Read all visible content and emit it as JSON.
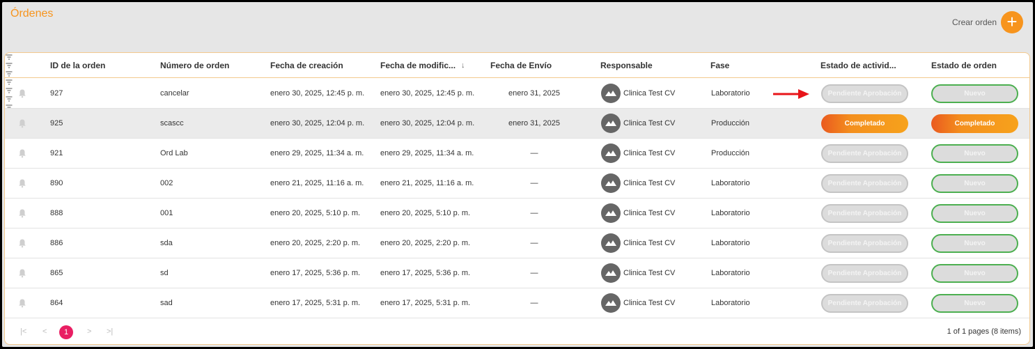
{
  "header": {
    "title": "Órdenes",
    "create_label": "Crear orden",
    "create_icon": "plus-icon"
  },
  "columns": [
    {
      "label": "ID de la orden"
    },
    {
      "label": "Número de orden"
    },
    {
      "label": "Fecha de creación"
    },
    {
      "label": "Fecha de modific...",
      "sort": "↓"
    },
    {
      "label": "Fecha de Envío"
    },
    {
      "label": "Responsable"
    },
    {
      "label": "Fase"
    },
    {
      "label": "Estado de activid..."
    },
    {
      "label": "Estado de orden"
    }
  ],
  "rows": [
    {
      "id": "927",
      "numero": "cancelar",
      "creacion": "enero 30, 2025, 12:45 p. m.",
      "modificacion": "enero 30, 2025, 12:45 p. m.",
      "envio": "enero 31, 2025",
      "responsable": "Clinica Test CV",
      "fase": "Laboratorio",
      "actividad": "Pendiente Aprobación",
      "orden": "Nuevo"
    },
    {
      "id": "925",
      "numero": "scascc",
      "creacion": "enero 30, 2025, 12:04 p. m.",
      "modificacion": "enero 30, 2025, 12:04 p. m.",
      "envio": "enero 31, 2025",
      "responsable": "Clinica Test CV",
      "fase": "Producción",
      "actividad": "Completado",
      "orden": "Completado"
    },
    {
      "id": "921",
      "numero": "Ord Lab",
      "creacion": "enero 29, 2025, 11:34 a. m.",
      "modificacion": "enero 29, 2025, 11:34 a. m.",
      "envio": "—",
      "responsable": "Clinica Test CV",
      "fase": "Producción",
      "actividad": "Pendiente Aprobación",
      "orden": "Nuevo"
    },
    {
      "id": "890",
      "numero": "002",
      "creacion": "enero 21, 2025, 11:16 a. m.",
      "modificacion": "enero 21, 2025, 11:16 a. m.",
      "envio": "—",
      "responsable": "Clinica Test CV",
      "fase": "Laboratorio",
      "actividad": "Pendiente Aprobación",
      "orden": "Nuevo"
    },
    {
      "id": "888",
      "numero": "001",
      "creacion": "enero 20, 2025, 5:10 p. m.",
      "modificacion": "enero 20, 2025, 5:10 p. m.",
      "envio": "—",
      "responsable": "Clinica Test CV",
      "fase": "Laboratorio",
      "actividad": "Pendiente Aprobación",
      "orden": "Nuevo"
    },
    {
      "id": "886",
      "numero": "sda",
      "creacion": "enero 20, 2025, 2:20 p. m.",
      "modificacion": "enero 20, 2025, 2:20 p. m.",
      "envio": "—",
      "responsable": "Clinica Test CV",
      "fase": "Laboratorio",
      "actividad": "Pendiente Aprobación",
      "orden": "Nuevo"
    },
    {
      "id": "865",
      "numero": "sd",
      "creacion": "enero 17, 2025, 5:36 p. m.",
      "modificacion": "enero 17, 2025, 5:36 p. m.",
      "envio": "—",
      "responsable": "Clinica Test CV",
      "fase": "Laboratorio",
      "actividad": "Pendiente Aprobación",
      "orden": "Nuevo"
    },
    {
      "id": "864",
      "numero": "sad",
      "creacion": "enero 17, 2025, 5:31 p. m.",
      "modificacion": "enero 17, 2025, 5:31 p. m.",
      "envio": "—",
      "responsable": "Clinica Test CV",
      "fase": "Laboratorio",
      "actividad": "Pendiente Aprobación",
      "orden": "Nuevo"
    }
  ],
  "pagination": {
    "current_page": "1",
    "info": "1 of 1 pages (8 items)"
  },
  "colors": {
    "accent": "#f7941d",
    "completed_gradient_start": "#ea5a1f",
    "completed_gradient_end": "#f7a21c",
    "nuevo_border": "#4caf50",
    "pager_current": "#e91e63",
    "annotation_arrow": "#e8141a"
  }
}
